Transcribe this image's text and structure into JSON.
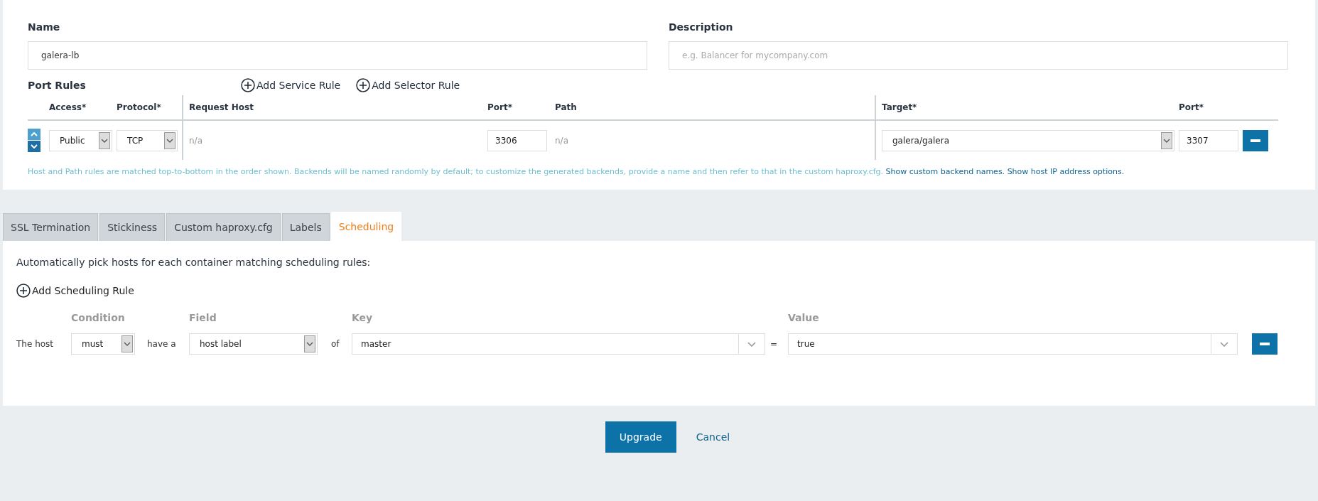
{
  "name": {
    "label": "Name",
    "value": "galera-lb"
  },
  "description": {
    "label": "Description",
    "placeholder": "e.g. Balancer for mycompany.com"
  },
  "port_rules": {
    "title": "Port Rules",
    "actions": [
      "Add Service Rule",
      "Add Selector Rule"
    ],
    "columns": [
      "Access*",
      "Protocol*",
      "Request Host",
      "Port*",
      "Path",
      "Target*",
      "Port*"
    ],
    "rows": [
      {
        "access": "Public",
        "protocol": "TCP",
        "request_host": "n/a",
        "port": "3306",
        "path": "n/a",
        "target": "galera/galera",
        "target_port": "3307"
      }
    ],
    "help": "Host and Path rules are matched top-to-bottom in the order shown. Backends will be named randomly by default; to customize the generated backends, provide a name and then refer to that in the custom haproxy.cfg.",
    "links": [
      "Show custom backend names.",
      "Show host IP address options."
    ]
  },
  "tabs": [
    {
      "label": "SSL Termination",
      "selected": false
    },
    {
      "label": "Stickiness",
      "selected": false
    },
    {
      "label": "Custom haproxy.cfg",
      "selected": false
    },
    {
      "label": "Labels",
      "selected": false
    },
    {
      "label": "Scheduling",
      "selected": true
    }
  ],
  "scheduling": {
    "intro": "Automatically pick hosts for each container matching scheduling rules:",
    "add": "Add Scheduling Rule",
    "columns": [
      "Condition",
      "Field",
      "Key",
      "Value"
    ],
    "rules": [
      {
        "prefix": "The host",
        "condition": "must",
        "middle": "have a",
        "field": "host label",
        "of": "of",
        "key": "master",
        "equals": "=",
        "value": "true"
      }
    ]
  },
  "buttons": {
    "primary": "Upgrade",
    "secondary": "Cancel"
  }
}
